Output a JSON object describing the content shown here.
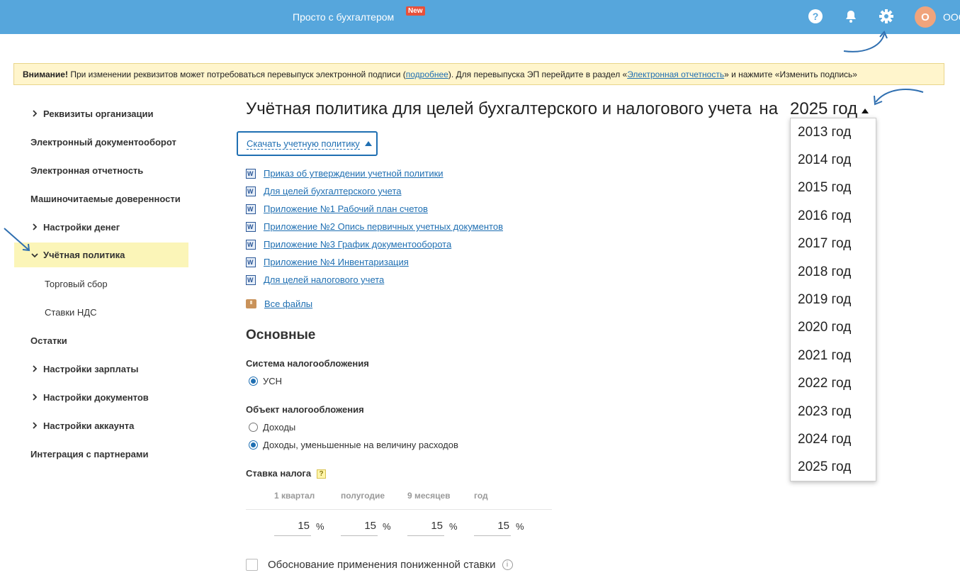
{
  "header": {
    "brand": "Просто с бухгалтером",
    "new_badge": "New",
    "avatar_letter": "О",
    "org_name": "ООО"
  },
  "warning": {
    "bold": "Внимание!",
    "text1": " При изменении реквизитов может потребоваться перевыпуск электронной подписи (",
    "link1": "подробнее",
    "text2": "). Для перевыпуска ЭП перейдите в раздел «",
    "link2": "Электронная отчетность",
    "text3": "» и нажмите «Изменить подпись»"
  },
  "sidebar": {
    "items": [
      {
        "label": "Реквизиты организации"
      },
      {
        "label": "Электронный документооборот"
      },
      {
        "label": "Электронная отчетность"
      },
      {
        "label": "Машиночитаемые доверенности"
      },
      {
        "label": "Настройки денег"
      },
      {
        "label": "Учётная политика"
      },
      {
        "label": "Торговый сбор"
      },
      {
        "label": "Ставки НДС"
      },
      {
        "label": "Остатки"
      },
      {
        "label": "Настройки зарплаты"
      },
      {
        "label": "Настройки документов"
      },
      {
        "label": "Настройки аккаунта"
      },
      {
        "label": "Интеграция с партнерами"
      }
    ]
  },
  "main": {
    "title": "Учётная политика для целей бухгалтерского и налогового учета",
    "year_prefix": "на",
    "year_selected": "2025 год",
    "download_button": "Скачать учетную политику",
    "documents": [
      "Приказ об утверждении учетной политики",
      "Для целей бухгалтерского учета",
      "Приложение №1 Рабочий план счетов",
      "Приложение №2 Опись первичных учетных документов",
      "Приложение №3 График документооборота",
      "Приложение №4 Инвентаризация",
      "Для целей налогового учета"
    ],
    "all_files": "Все файлы",
    "section_title": "Основные",
    "tax_system_label": "Система налогообложения",
    "tax_system_option": "УСН",
    "tax_object_label": "Объект налогообложения",
    "tax_object_options": [
      "Доходы",
      "Доходы, уменьшенные на величину расходов"
    ],
    "tax_object_selected": "Доходы, уменьшенные на величину расходов",
    "rate_label": "Ставка налога",
    "rate_help": "?",
    "rate_periods": [
      "1 квартал",
      "полугодие",
      "9 месяцев",
      "год"
    ],
    "rate_values": [
      "15",
      "15",
      "15",
      "15"
    ],
    "percent": "%",
    "reduced_rate_label": "Обоснование применения пониженной ставки",
    "info_glyph": "i"
  },
  "year_dropdown": {
    "options": [
      "2013 год",
      "2014 год",
      "2015 год",
      "2016 год",
      "2017 год",
      "2018 год",
      "2019 год",
      "2020 год",
      "2021 год",
      "2022 год",
      "2023 год",
      "2024 год",
      "2025 год"
    ]
  },
  "colors": {
    "header_bg": "#56a6dc",
    "link": "#1f6fb2",
    "active_item_bg": "#fbf5b8",
    "warning_bg": "#fff5cc"
  }
}
